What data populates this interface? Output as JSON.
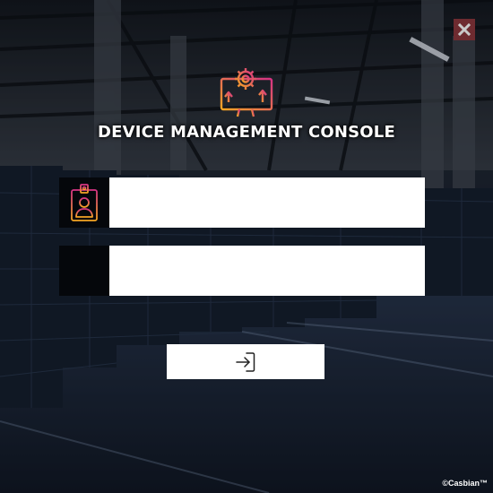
{
  "header": {
    "title": "DEVICE MANAGEMENT CONSOLE",
    "logo_icon": "monitor-gear-icon",
    "close_icon": "close-icon"
  },
  "form": {
    "username": {
      "icon": "user-badge-icon",
      "value": "",
      "placeholder": ""
    },
    "password": {
      "value": "",
      "placeholder": ""
    },
    "login_icon": "sign-in-icon"
  },
  "footer": {
    "brand": "©Casbian™"
  },
  "colors": {
    "close_bg": "#6e2b30",
    "accent_orange": "#f39c12",
    "accent_magenta": "#d63384",
    "input_bg": "#ffffff",
    "icon_box_bg": "#05070b"
  }
}
